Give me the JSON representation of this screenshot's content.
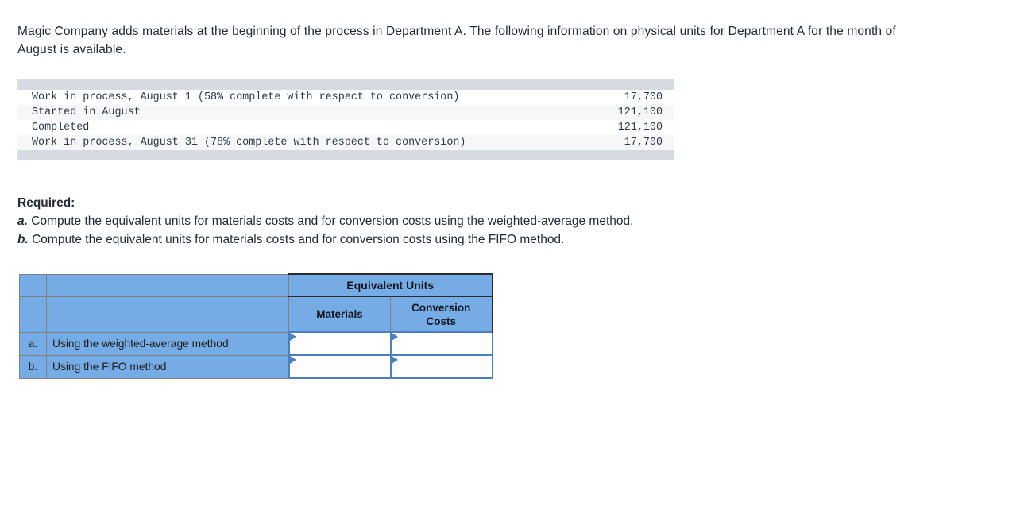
{
  "intro": {
    "text": "Magic Company adds materials at the beginning of the process in Department A. The following information on physical units for Department A for the month of August is available."
  },
  "data_table": {
    "rows": [
      {
        "label": "Work in process, August 1 (58% complete with respect to conversion)",
        "value": "17,700"
      },
      {
        "label": "Started in August",
        "value": "121,100"
      },
      {
        "label": "Completed",
        "value": "121,100"
      },
      {
        "label": "Work in process, August 31 (78% complete with respect to conversion)",
        "value": "17,700"
      }
    ]
  },
  "required": {
    "heading": "Required:",
    "items": [
      {
        "letter": "a.",
        "text": "Compute the equivalent units for materials costs and for conversion costs using the weighted-average method."
      },
      {
        "letter": "b.",
        "text": "Compute the equivalent units for materials costs and for conversion costs using the FIFO method."
      }
    ]
  },
  "answer_table": {
    "group_header": "Equivalent Units",
    "columns": [
      "Materials",
      "Conversion Costs"
    ],
    "column_materials": "Materials",
    "column_conversion_line1": "Conversion",
    "column_conversion_line2": "Costs",
    "rows": [
      {
        "letter": "a.",
        "description": "Using the weighted-average method",
        "materials": "",
        "conversion": ""
      },
      {
        "letter": "b.",
        "description": "Using the FIFO method",
        "materials": "",
        "conversion": ""
      }
    ]
  },
  "colors": {
    "header_fill": "#75ace6",
    "band_fill": "#d5dae3",
    "stripe_fill": "#f7f7f7",
    "input_border": "#4a80c0",
    "text": "#262b34"
  }
}
